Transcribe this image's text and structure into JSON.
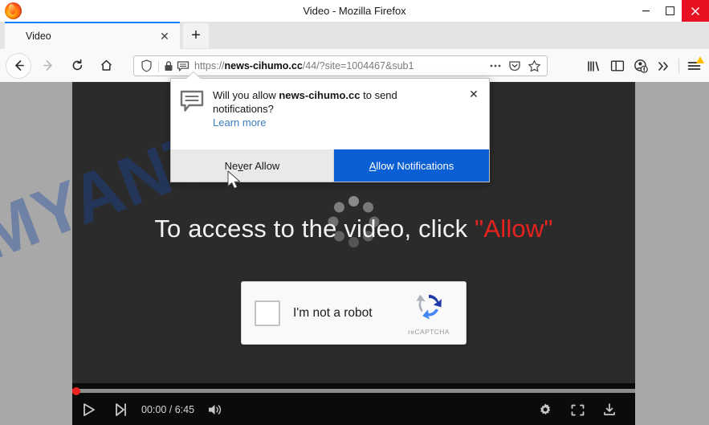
{
  "window": {
    "title": "Video - Mozilla Firefox",
    "logo_icon": "firefox-logo",
    "minimize_label": "–",
    "maximize_label": "maximize",
    "close_label": "✕"
  },
  "tabs": {
    "active": {
      "label": "Video",
      "close_label": "✕"
    },
    "new_tab_label": "+"
  },
  "navigation": {
    "back_icon": "back-arrow-icon",
    "forward_icon": "forward-arrow-icon",
    "reload_icon": "reload-icon",
    "home_icon": "home-icon"
  },
  "urlbar": {
    "shield_icon": "tracking-protection-shield-icon",
    "lock_icon": "padlock-icon",
    "permission_icon": "notification-permission-icon",
    "url_scheme": "https://",
    "url_host": "news-cihumo.cc",
    "url_path": "/44/?site=1004467&sub1",
    "page_actions_icon": "ellipsis-icon",
    "pocket_icon": "pocket-icon",
    "bookmark_icon": "star-icon"
  },
  "toolbar_right": {
    "library_icon": "library-icon",
    "sidebar_icon": "sidebar-icon",
    "account_icon": "account-warning-icon",
    "overflow_icon": "chevron-double-right-icon",
    "menu_icon": "hamburger-menu-icon",
    "menu_badge_icon": "warning-triangle-icon"
  },
  "doorhanger": {
    "icon": "chat-bubble-icon",
    "question_prefix": "Will you allow ",
    "question_domain": "news-cihumo.cc",
    "question_suffix": " to send notifications?",
    "learn_more": "Learn more",
    "close_label": "✕",
    "never_allow": {
      "before": "Ne",
      "key": "v",
      "after": "er Allow"
    },
    "allow_notifications": {
      "key": "A",
      "after": "llow Notifications"
    }
  },
  "page": {
    "watermark": "MYANTISPYWARE.COM",
    "watermark_color": "#1a48a0",
    "headline_text": "To access to the video, click ",
    "headline_allow": "\"Allow\"",
    "headline_allow_color": "#e8231f",
    "spinner_icon": "loading-spinner-icon"
  },
  "recaptcha": {
    "checkbox_name": "recaptcha-checkbox",
    "label": "I'm not a robot",
    "brand_name": "reCAPTCHA",
    "logo_icon": "recaptcha-logo-icon"
  },
  "player": {
    "play_icon": "play-icon",
    "next_icon": "next-track-icon",
    "time_display": "00:00 / 6:45",
    "current_time": "00:00",
    "duration": "6:45",
    "volume_icon": "volume-icon",
    "settings_icon": "gear-icon",
    "fullscreen_icon": "fullscreen-icon",
    "download_icon": "download-icon",
    "progress_percent": 0
  }
}
